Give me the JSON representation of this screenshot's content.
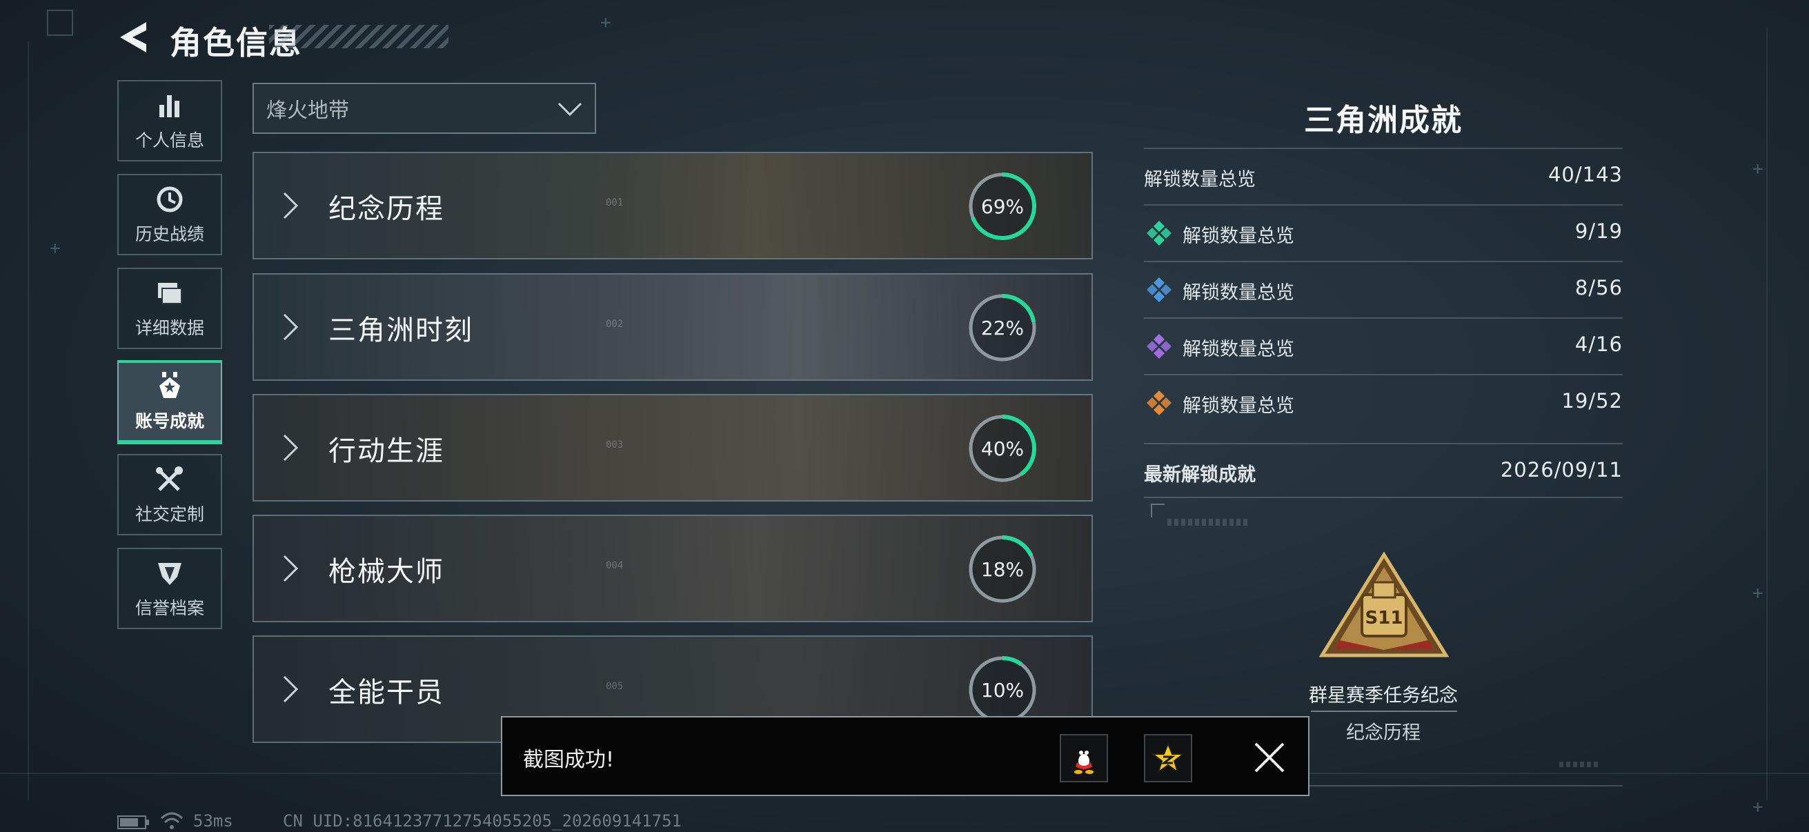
{
  "header": {
    "title": "角色信息"
  },
  "sidebar": {
    "items": [
      {
        "label": "个人信息",
        "icon": "bar-chart-icon"
      },
      {
        "label": "历史战绩",
        "icon": "history-icon"
      },
      {
        "label": "详细数据",
        "icon": "folders-icon"
      },
      {
        "label": "账号成就",
        "icon": "medal-icon",
        "active": true
      },
      {
        "label": "社交定制",
        "icon": "tools-icon"
      },
      {
        "label": "信誉档案",
        "icon": "shield-icon"
      }
    ]
  },
  "mode_select": {
    "value": "烽火地带"
  },
  "categories": [
    {
      "label": "纪念历程",
      "percent": "69%",
      "progress": 0.69,
      "code": "001"
    },
    {
      "label": "三角洲时刻",
      "percent": "22%",
      "progress": 0.22,
      "code": "002"
    },
    {
      "label": "行动生涯",
      "percent": "40%",
      "progress": 0.4,
      "code": "003"
    },
    {
      "label": "枪械大师",
      "percent": "18%",
      "progress": 0.18,
      "code": "004"
    },
    {
      "label": "全能干员",
      "percent": "10%",
      "progress": 0.1,
      "code": "005"
    }
  ],
  "panel": {
    "title": "三角洲成就",
    "stats": [
      {
        "label": "解锁数量总览",
        "value": "40/143",
        "icon": ""
      },
      {
        "label": "解锁数量总览",
        "value": "9/19",
        "icon": "green-diamond-icon",
        "color": "#2fd3a0"
      },
      {
        "label": "解锁数量总览",
        "value": "8/56",
        "icon": "blue-diamond-icon",
        "color": "#4f97de"
      },
      {
        "label": "解锁数量总览",
        "value": "4/16",
        "icon": "purple-diamond-icon",
        "color": "#a06ee0"
      },
      {
        "label": "解锁数量总览",
        "value": "19/52",
        "icon": "orange-diamond-icon",
        "color": "#e48a38"
      }
    ],
    "latest": {
      "label": "最新解锁成就",
      "date": "2026/09/11"
    },
    "achievement": {
      "name": "群星赛季任务纪念",
      "category": "纪念历程",
      "badge_text": "S11"
    }
  },
  "toast": {
    "message": "截图成功!"
  },
  "status_bar": {
    "ping": "53ms",
    "uid": "CN UID:81641237712754055205_202609141751"
  },
  "colors": {
    "accent": "#26d99a",
    "ring_track": "#8e9aa0"
  }
}
